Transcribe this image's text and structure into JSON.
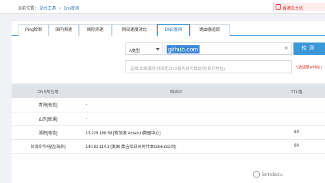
{
  "breadcrumb": {
    "prefix": "当前位置：",
    "home": "站长工具",
    "separator": ">",
    "current": "Dns查询"
  },
  "promo": {
    "text": "香港云主机"
  },
  "tabs": [
    {
      "label": "Ping检测",
      "active": false
    },
    {
      "label": "国内测速",
      "active": false
    },
    {
      "label": "国际测速",
      "active": false
    },
    {
      "label": "网站速度对比",
      "active": false
    },
    {
      "label": "DNS查询",
      "active": true
    },
    {
      "label": "路由器追踪",
      "active": false
    }
  ],
  "query": {
    "record_type": "A类型",
    "host": "github.com",
    "button": "检测",
    "servers_placeholder": "选填,如果要针对指定DNS服务器可填此项(即IP地址)",
    "hint": "*(选填限IP地址)"
  },
  "results": {
    "headers": [
      "DNS所在地",
      "响应IP",
      "TTL值"
    ],
    "rows": [
      {
        "location": "青海[电信]",
        "ip": "-",
        "ttl": ""
      },
      {
        "location": "山东[联通]",
        "ip": "-",
        "ttl": ""
      },
      {
        "location": "湖南[电信]",
        "ip": "13.229.188.59 [新加坡 Amazon数据中心]",
        "ttl": "60"
      },
      {
        "location": "台湾中华电信[海外]",
        "ip": "140.82.114.3 [美国 弗吉尼亚州阿什本GitHub公司]",
        "ttl": "60"
      }
    ]
  },
  "watermark": {
    "text": "lamdaxu",
    "icon": "wechat-icon"
  },
  "colors": {
    "accent": "#3a97d8",
    "warning": "#dd3333",
    "header_bg": "#dfe3e8"
  }
}
